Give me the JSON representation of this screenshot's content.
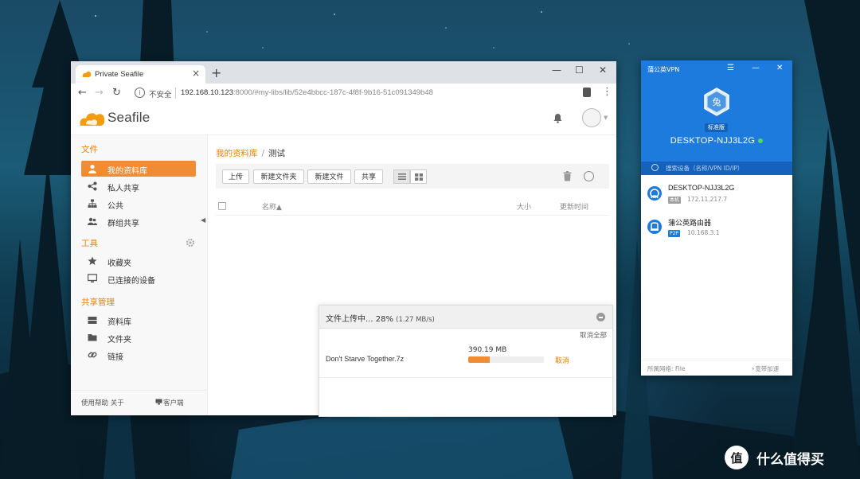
{
  "browser": {
    "tab_title": "Private Seafile",
    "tab_close": "×",
    "new_tab": "+",
    "win_min": "—",
    "win_max": "☐",
    "win_close": "✕",
    "insecure_label": "不安全",
    "url_host": "192.168.10.123",
    "url_rest": ":8000/#my-libs/lib/52e4bbcc-187c-4f8f-9b16-51c091349b48"
  },
  "seafile": {
    "logo_text": "Seafile",
    "sidebar": {
      "files_heading": "文件",
      "items_files": [
        {
          "label": "我的资料库",
          "active": true
        },
        {
          "label": "私人共享"
        },
        {
          "label": "公共"
        },
        {
          "label": "群组共享"
        }
      ],
      "tools_heading": "工具",
      "items_tools": [
        {
          "label": "收藏夹"
        },
        {
          "label": "已连接的设备"
        }
      ],
      "share_heading": "共享管理",
      "items_share": [
        {
          "label": "资料库"
        },
        {
          "label": "文件夹"
        },
        {
          "label": "链接"
        }
      ],
      "footer_left": "使用帮助  关于",
      "footer_right": "客户端"
    },
    "breadcrumb": {
      "root": "我的资料库",
      "sep": "/",
      "current": "测试"
    },
    "toolbar": {
      "upload": "上传",
      "new_folder": "新建文件夹",
      "new_file": "新建文件",
      "share": "共享"
    },
    "table_header": {
      "name": "名称▲",
      "size": "大小",
      "modified": "更新时间"
    }
  },
  "upload_panel": {
    "title": "文件上传中... 28%",
    "rate": "(1.27 MB/s)",
    "cancel_all": "取消全部",
    "file_name": "Don't Starve Together.7z",
    "file_size": "390.19 MB",
    "progress": 0.28,
    "cancel": "取消"
  },
  "vpn": {
    "title": "蒲公英VPN",
    "menu": "☰",
    "min": "—",
    "close": "✕",
    "avatar_char": "兔",
    "edition_badge": "标准版",
    "device_name": "DESKTOP-NJJ3L2G",
    "search_placeholder": "搜索设备（名称/VPN ID/IP）",
    "peers": [
      {
        "name": "DESKTOP-NJJ3L2G",
        "tag": "本机",
        "tag_color": "#a0a0a0",
        "ip": "172.11.217.7"
      },
      {
        "name": "蒲公英路由器",
        "tag": "P2P",
        "tag_color": "#1e7bde",
        "ip": "10.168.3.1"
      }
    ],
    "footer_left": "所属网络: File",
    "footer_right": "宽带加速",
    "accent": "#1e7bde"
  },
  "watermark": {
    "text": "什么值得买",
    "icon_char": "值"
  }
}
